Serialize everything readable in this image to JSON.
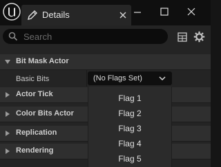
{
  "tab": {
    "title": "Details"
  },
  "search": {
    "placeholder": "Search",
    "value": ""
  },
  "categories": {
    "bit_mask_actor": "Bit Mask Actor",
    "actor_tick": "Actor Tick",
    "color_bits_actor": "Color Bits Actor",
    "replication": "Replication",
    "rendering": "Rendering"
  },
  "property": {
    "label": "Basic Bits",
    "value": "(No Flags Set)"
  },
  "menu": {
    "items": [
      "Flag 1",
      "Flag 2",
      "Flag 3",
      "Flag 4",
      "Flag 5"
    ]
  },
  "colors": {
    "background": "#242424",
    "category_bar": "#2f2f2f",
    "menu": "#2b2b2b",
    "titlebar": "#0f0f0f"
  }
}
